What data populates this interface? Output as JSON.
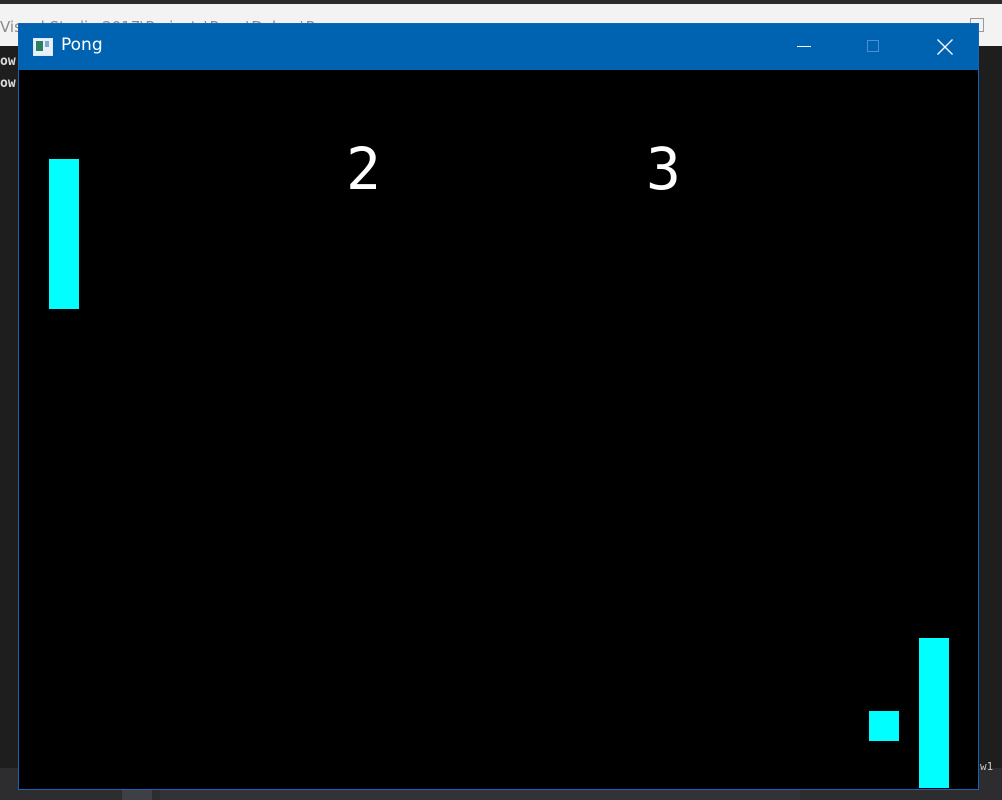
{
  "background": {
    "path_text": "Visual Studio 2017\\Projects\\Pong\\Debug\\P",
    "left_lines": [
      "ow",
      "ow"
    ],
    "right_text": "w1"
  },
  "window": {
    "title": "Pong",
    "app_icon": "window-app-icon",
    "controls": {
      "minimize": "minimize-icon",
      "maximize": "maximize-icon",
      "close": "close-icon"
    },
    "titlebar_color": "#0063b1"
  },
  "game": {
    "background_color": "#000000",
    "object_color": "#00ffff",
    "score_color": "#ffffff",
    "score_left": "2",
    "score_right": "3"
  }
}
